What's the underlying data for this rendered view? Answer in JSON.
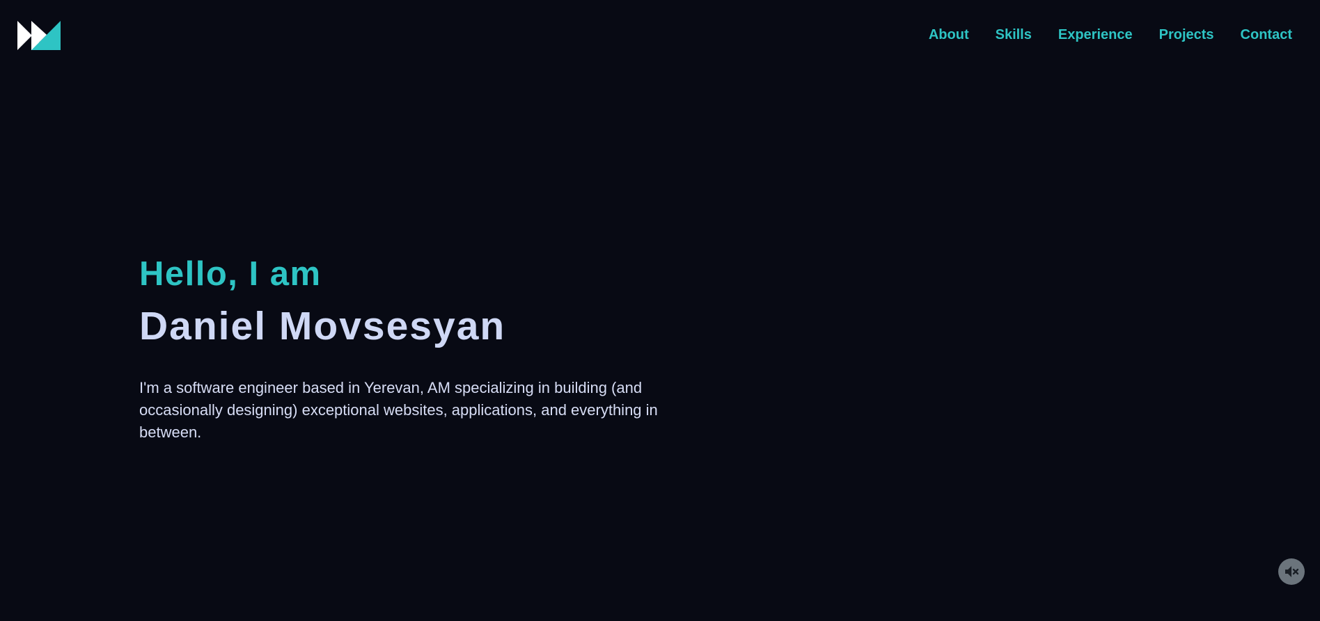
{
  "header": {
    "logo_icon": "mm-logo-icon",
    "nav": [
      {
        "label": "About"
      },
      {
        "label": "Skills"
      },
      {
        "label": "Experience"
      },
      {
        "label": "Projects"
      },
      {
        "label": "Contact"
      }
    ]
  },
  "hero": {
    "greeting": "Hello, I am",
    "name": "Daniel Movsesyan",
    "bio": "I'm a software engineer based in Yerevan, AM specializing in building (and occasionally designing) exceptional websites, applications, and everything in between."
  },
  "audio": {
    "icon": "speaker-muted-icon"
  },
  "colors": {
    "background": "#080a14",
    "accent": "#2ec4c4",
    "heading": "#cfd8f5",
    "text": "#d7ddf5",
    "mute_button": "#6b747c"
  }
}
